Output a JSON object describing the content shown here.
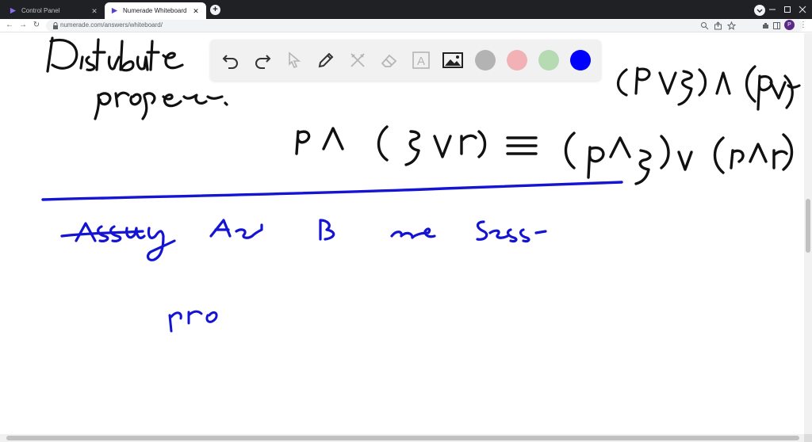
{
  "browser": {
    "tabs": [
      {
        "title": "Control Panel",
        "active": false
      },
      {
        "title": "Numerade Whiteboard",
        "active": true
      }
    ],
    "new_tab_label": "+",
    "close_glyph": "✕",
    "url": "numerade.com/answers/whiteboard/",
    "profile_initial": "P",
    "icons": [
      "back-icon",
      "forward-icon",
      "reload-icon",
      "lock-icon",
      "zoom-icon",
      "share-icon",
      "star-icon",
      "extensions-icon",
      "sidepanel-icon",
      "profile-avatar",
      "menu-icon"
    ]
  },
  "whiteboard_toolbar": {
    "tools": [
      "undo-icon",
      "redo-icon",
      "select-icon",
      "pen-icon",
      "tools-icon",
      "eraser-icon",
      "text-icon",
      "image-icon"
    ],
    "text_tool_glyph": "A",
    "colors": [
      {
        "name": "gray",
        "hex": "#b3b3b3"
      },
      {
        "name": "pink",
        "hex": "#f2b1b5"
      },
      {
        "name": "green",
        "hex": "#b6dbb3"
      },
      {
        "name": "blue",
        "hex": "#0000ff",
        "selected": true
      }
    ]
  },
  "colors": {
    "ink_black": "#111111",
    "ink_blue": "#1414d2",
    "tab_bar": "#202124",
    "accent_profile": "#5b2a86"
  }
}
